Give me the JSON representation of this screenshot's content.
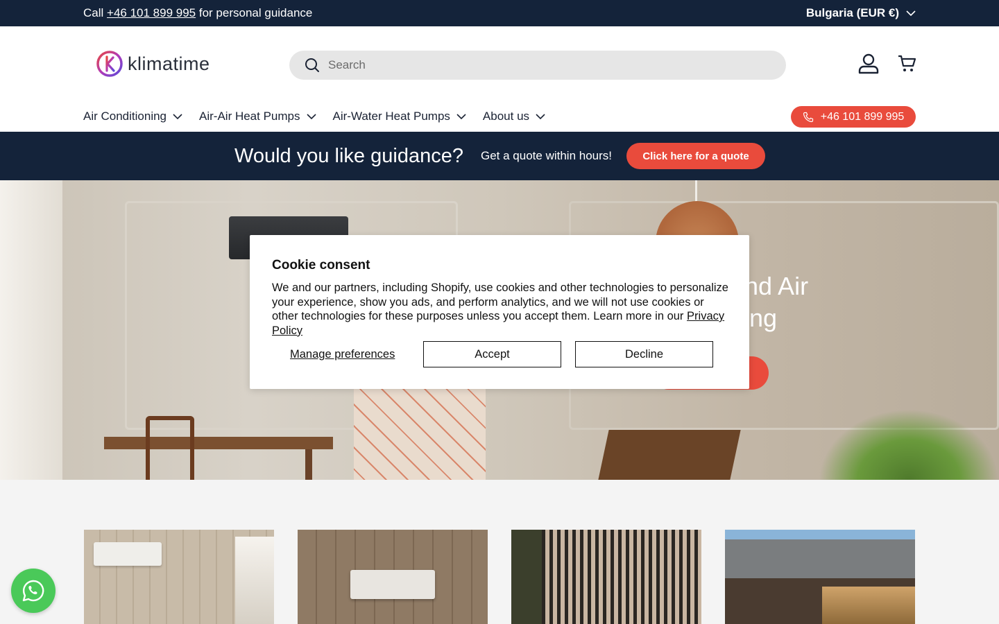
{
  "topbar": {
    "call_prefix": "Call",
    "phone": "+46 101 899 995",
    "call_suffix": "for personal guidance",
    "country": "Bulgaria (EUR €)"
  },
  "header": {
    "logo_text": "klimatime",
    "search_placeholder": "Search"
  },
  "nav": {
    "items": [
      {
        "label": "Air Conditioning"
      },
      {
        "label": "Air-Air Heat Pumps"
      },
      {
        "label": "Air-Water Heat Pumps"
      },
      {
        "label": "About us"
      }
    ],
    "phone_button": "+46 101 899 995"
  },
  "guidance": {
    "title": "Would you like guidance?",
    "subtitle": "Get a quote within hours!",
    "button": "Click here for a quote"
  },
  "hero": {
    "heading_line1": "nd Air",
    "heading_line2": "ng"
  },
  "cookie": {
    "title": "Cookie consent",
    "text": "We and our partners, including Shopify, use cookies and other technologies to personalize your experience, show you ads, and perform analytics, and we will not use cookies or other technologies for these purposes unless you accept them. Learn more in our",
    "privacy_link": "Privacy Policy",
    "manage": "Manage preferences",
    "accept": "Accept",
    "decline": "Decline"
  },
  "colors": {
    "navy": "#14233a",
    "accent": "#e94b3c",
    "whatsapp": "#4ac959"
  }
}
